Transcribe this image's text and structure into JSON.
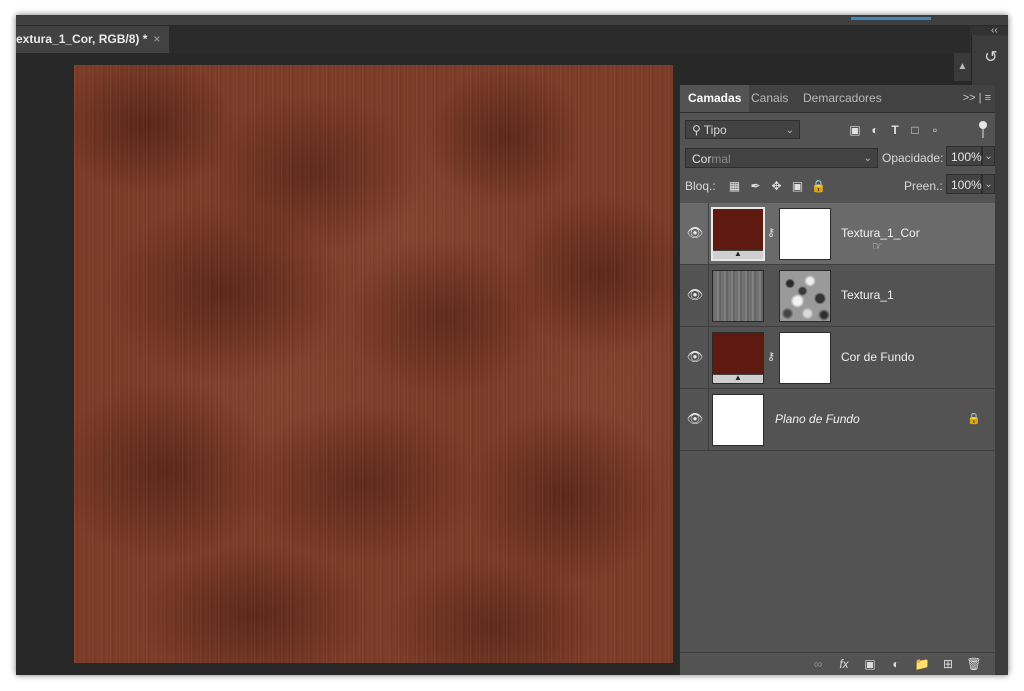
{
  "document_tab": {
    "title": "extura_1_Cor, RGB/8) *",
    "close": "×"
  },
  "panel_collapse": "‹‹",
  "right_strip": {
    "history_icon": "history-brush-icon"
  },
  "canvas": {
    "texture_color": "#7b3b26"
  },
  "layers_panel": {
    "tabs": [
      {
        "label": "Camadas",
        "active": true
      },
      {
        "label": "Canais",
        "active": false
      },
      {
        "label": "Demarcadores",
        "active": false
      }
    ],
    "menu": ">> | ≡",
    "filter": {
      "value": "Tipo"
    },
    "blend_mode": {
      "typed": "Cor",
      "suggestion": "mal"
    },
    "opacity": {
      "label": "Opacidade:",
      "value": "100%"
    },
    "lock": {
      "label": "Bloq.:"
    },
    "fill": {
      "label": "Preen.:",
      "value": "100%"
    },
    "layers": [
      {
        "name": "Textura_1_Cor",
        "selected": true,
        "type": "solid-color"
      },
      {
        "name": "Textura_1",
        "selected": false,
        "type": "texture"
      },
      {
        "name": "Cor de Fundo",
        "selected": false,
        "type": "solid-color"
      },
      {
        "name": "Plano de Fundo",
        "selected": false,
        "type": "background",
        "locked": true
      }
    ],
    "colors": {
      "solid_fill": "#5e1a0e",
      "selected_row": "#6a6a6a",
      "panel_bg": "#535353"
    }
  }
}
